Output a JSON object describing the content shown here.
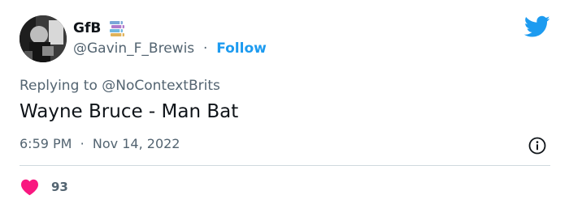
{
  "author": {
    "display_name": "GfB",
    "handle": "@Gavin_F_Brewis",
    "separator": "·",
    "follow_label": "Follow",
    "badge_icon": "books-icon"
  },
  "reply": {
    "prefix": "Replying to",
    "handle": "@NoContextBrits"
  },
  "tweet": {
    "text": "Wayne Bruce - Man Bat",
    "time": "6:59 PM",
    "separator": "·",
    "date": "Nov 14, 2022"
  },
  "engagement": {
    "like_icon": "heart-icon",
    "likes": "93"
  },
  "icons": {
    "platform": "twitter-bird-icon",
    "info": "info-icon"
  },
  "colors": {
    "accent": "#1d9bf0",
    "heart": "#f91880",
    "secondary_text": "#536471",
    "primary_text": "#0f1419",
    "divider": "#cfd9de"
  }
}
